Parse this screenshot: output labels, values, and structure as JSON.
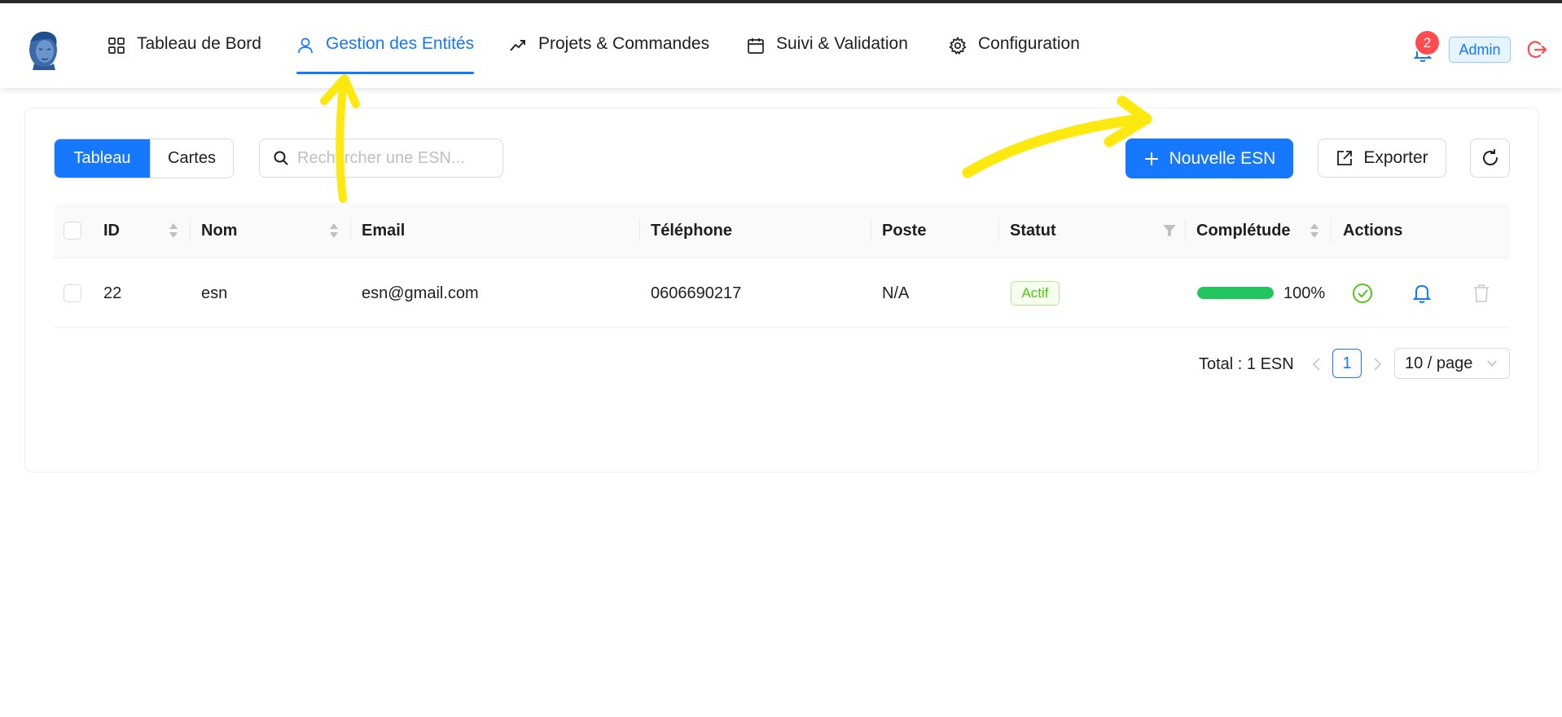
{
  "header": {
    "nav": [
      {
        "label": "Tableau de Bord",
        "icon": "grid-icon"
      },
      {
        "label": "Gestion des Entités",
        "icon": "user-icon",
        "active": true
      },
      {
        "label": "Projets & Commandes",
        "icon": "trend-icon"
      },
      {
        "label": "Suivi & Validation",
        "icon": "calendar-icon"
      },
      {
        "label": "Configuration",
        "icon": "gear-icon"
      }
    ],
    "notification_count": "2",
    "user_role": "Admin"
  },
  "toolbar": {
    "view_table": "Tableau",
    "view_cards": "Cartes",
    "search_placeholder": "Rechercher une ESN...",
    "new_button": "Nouvelle ESN",
    "export_button": "Exporter"
  },
  "table": {
    "columns": [
      "ID",
      "Nom",
      "Email",
      "Téléphone",
      "Poste",
      "Statut",
      "Complétude",
      "Actions"
    ],
    "rows": [
      {
        "id": "22",
        "nom": "esn",
        "email": "esn@gmail.com",
        "telephone": "0606690217",
        "poste": "N/A",
        "statut": "Actif",
        "completude": "100%",
        "completude_value": 1.0
      }
    ]
  },
  "pagination": {
    "total": "Total : 1 ESN",
    "current_page": "1",
    "page_size": "10 / page"
  },
  "colors": {
    "primary": "#1677ff",
    "success": "#52c41a",
    "progress": "#22c55e",
    "danger": "#ff4d4f",
    "annotation": "#fde910"
  }
}
